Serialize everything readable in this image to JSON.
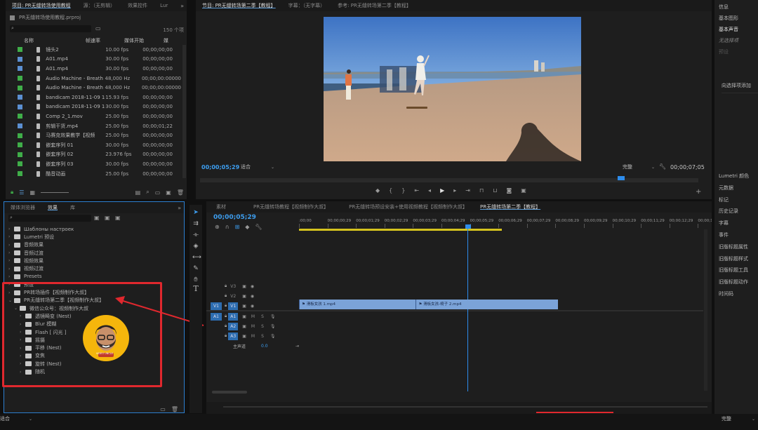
{
  "project": {
    "tabs": [
      "项目: PR无缝转场使用教程",
      "源：（无剪辑）",
      "效果控件",
      "Lur"
    ],
    "project_file": "PR无缝转场使用教程.prproj",
    "item_count": "150 个项",
    "columns": [
      "名称",
      "帧速率",
      "媒体开始",
      "媒"
    ],
    "items": [
      {
        "color": "#3fae49",
        "name": "镜头2",
        "fps": "10.00 fps",
        "start": "00;00;00;00"
      },
      {
        "color": "#5b8fd1",
        "name": "A01.mp4",
        "fps": "30.00 fps",
        "start": "00;00;00;00"
      },
      {
        "color": "#5b8fd1",
        "name": "A01.mp4",
        "fps": "30.00 fps",
        "start": "00;00;00;00"
      },
      {
        "color": "#3fae49",
        "name": "Audio Machine - Breath and",
        "fps": "48,000 Hz",
        "start": "00;00;00:00000"
      },
      {
        "color": "#3fae49",
        "name": "Audio Machine - Breath and",
        "fps": "48,000 Hz",
        "start": "00;00;00:00000"
      },
      {
        "color": "#5b8fd1",
        "name": "bandicam 2018-11-09 10-42-",
        "fps": "15.93 fps",
        "start": "00;00;00;00"
      },
      {
        "color": "#5b8fd1",
        "name": "bandicam 2018-11-09 10-47-",
        "fps": "30.00 fps",
        "start": "00;00;00;00"
      },
      {
        "color": "#3fae49",
        "name": "Comp 2_1.mov",
        "fps": "25.00 fps",
        "start": "00;00;00;00"
      },
      {
        "color": "#5b8fd1",
        "name": "剪辑干货.mp4",
        "fps": "25.00 fps",
        "start": "00;00;01;22"
      },
      {
        "color": "#3fae49",
        "name": "马赛克效果教学【视频",
        "fps": "25.00 fps",
        "start": "00;00;00;00"
      },
      {
        "color": "#3fae49",
        "name": "嵌套序列 01",
        "fps": "30.00 fps",
        "start": "00;00;00;00"
      },
      {
        "color": "#3fae49",
        "name": "嵌套序列 02",
        "fps": "23.976 fps",
        "start": "00;00;00;00"
      },
      {
        "color": "#3fae49",
        "name": "嵌套序列 03",
        "fps": "30.00 fps",
        "start": "00;00;00;00"
      },
      {
        "color": "#3fae49",
        "name": "酷音动画",
        "fps": "25.00 fps",
        "start": "00;00;00;00"
      }
    ]
  },
  "program": {
    "tabs": [
      "节目: PR无缝转场第二季【教程】",
      "字幕：（无字幕）",
      "参考: PR无缝转场第二季【教程】"
    ],
    "timecode": "00;00;05;29",
    "fit": "适合",
    "quality": "完整",
    "duration": "00;00;07;05"
  },
  "effects": {
    "tabs": [
      "媒体浏览器",
      "效果",
      "库"
    ],
    "tree": [
      {
        "label": "Шаблоны настроек",
        "indent": 0
      },
      {
        "label": "Lumetri 预设",
        "indent": 0
      },
      {
        "label": "音频效果",
        "indent": 0
      },
      {
        "label": "音频过渡",
        "indent": 0
      },
      {
        "label": "视频效果",
        "indent": 0
      },
      {
        "label": "视频过渡",
        "indent": 0
      },
      {
        "label": "Presets",
        "indent": 0
      },
      {
        "label": "预设",
        "indent": 0
      },
      {
        "label": "PR转场插件【视频制作大叔】",
        "indent": 0
      },
      {
        "label": "PR无缝转场第二季【视频制作大叔】",
        "indent": 0,
        "open": true
      },
      {
        "label": "微信公众号：视频制作大叔",
        "indent": 1,
        "open": true
      },
      {
        "label": "透镜畸变 (Nest)",
        "indent": 2
      },
      {
        "label": "Blur 模糊",
        "indent": 2
      },
      {
        "label": "Flash [ 闪光 ]",
        "indent": 2
      },
      {
        "label": "摇摄",
        "indent": 2
      },
      {
        "label": "平移 (Nest)",
        "indent": 2
      },
      {
        "label": "变焦",
        "indent": 2
      },
      {
        "label": "旋转 (Nest)",
        "indent": 2
      },
      {
        "label": "随机",
        "indent": 2
      }
    ],
    "avatar_badge": "VIDEO UNCLE"
  },
  "timeline": {
    "tabs": [
      "素材",
      "PR无缝转场教程【视频制作大叔】",
      "PR无缝转场预设安装+使用视频教程【视频制作大叔】",
      "PR无缝转场第二季【教程】"
    ],
    "timecode": "00;00;05;29",
    "ruler": [
      ":00;00",
      "00;00;00;29",
      "00;00;01;29",
      "00;00;02;29",
      "00;00;03;29",
      "00;00;04;29",
      "00;00;05;29",
      "00;00;06;29",
      "00;00;07;29",
      "00;00;08;29",
      "00;00;09;29",
      "00;00;10;29",
      "00;00;11;29",
      "00;00;12;29",
      "00;00;13;2"
    ],
    "video_tracks": [
      "V3",
      "V2",
      "V1"
    ],
    "audio_tracks": [
      "A1",
      "A2",
      "A3"
    ],
    "source_v": "V1",
    "source_a": "A1",
    "mix_label": "主声道",
    "mix_value": "0.0",
    "clips": [
      {
        "label": "滑板女孩 1.mp4",
        "start": 0,
        "end": 4.1
      },
      {
        "label": "滑板女孩-椅子 2.mp4",
        "start": 4.1,
        "end": 9.1
      }
    ],
    "playhead_seconds": 5.97,
    "in_out_seconds": [
      0,
      9.1
    ]
  },
  "right_panel": {
    "top": [
      "信息",
      "基本图形",
      "基本声音",
      "无选择项",
      "预设"
    ],
    "select_hint": "向选择项添加",
    "list": [
      "Lumetri 颜色",
      "元数据",
      "标记",
      "历史记录",
      "字幕",
      "事件",
      "旧版标题属性",
      "旧版标题样式",
      "旧版标题工具",
      "旧版标题动作",
      "时间码"
    ]
  },
  "bottom": {
    "left_select": "适合",
    "right_select": "完整"
  },
  "colors": {
    "accent": "#2d8ceb",
    "clip": "#7ba3d8",
    "annotation": "#e0282e",
    "inout": "#d4c21e"
  }
}
